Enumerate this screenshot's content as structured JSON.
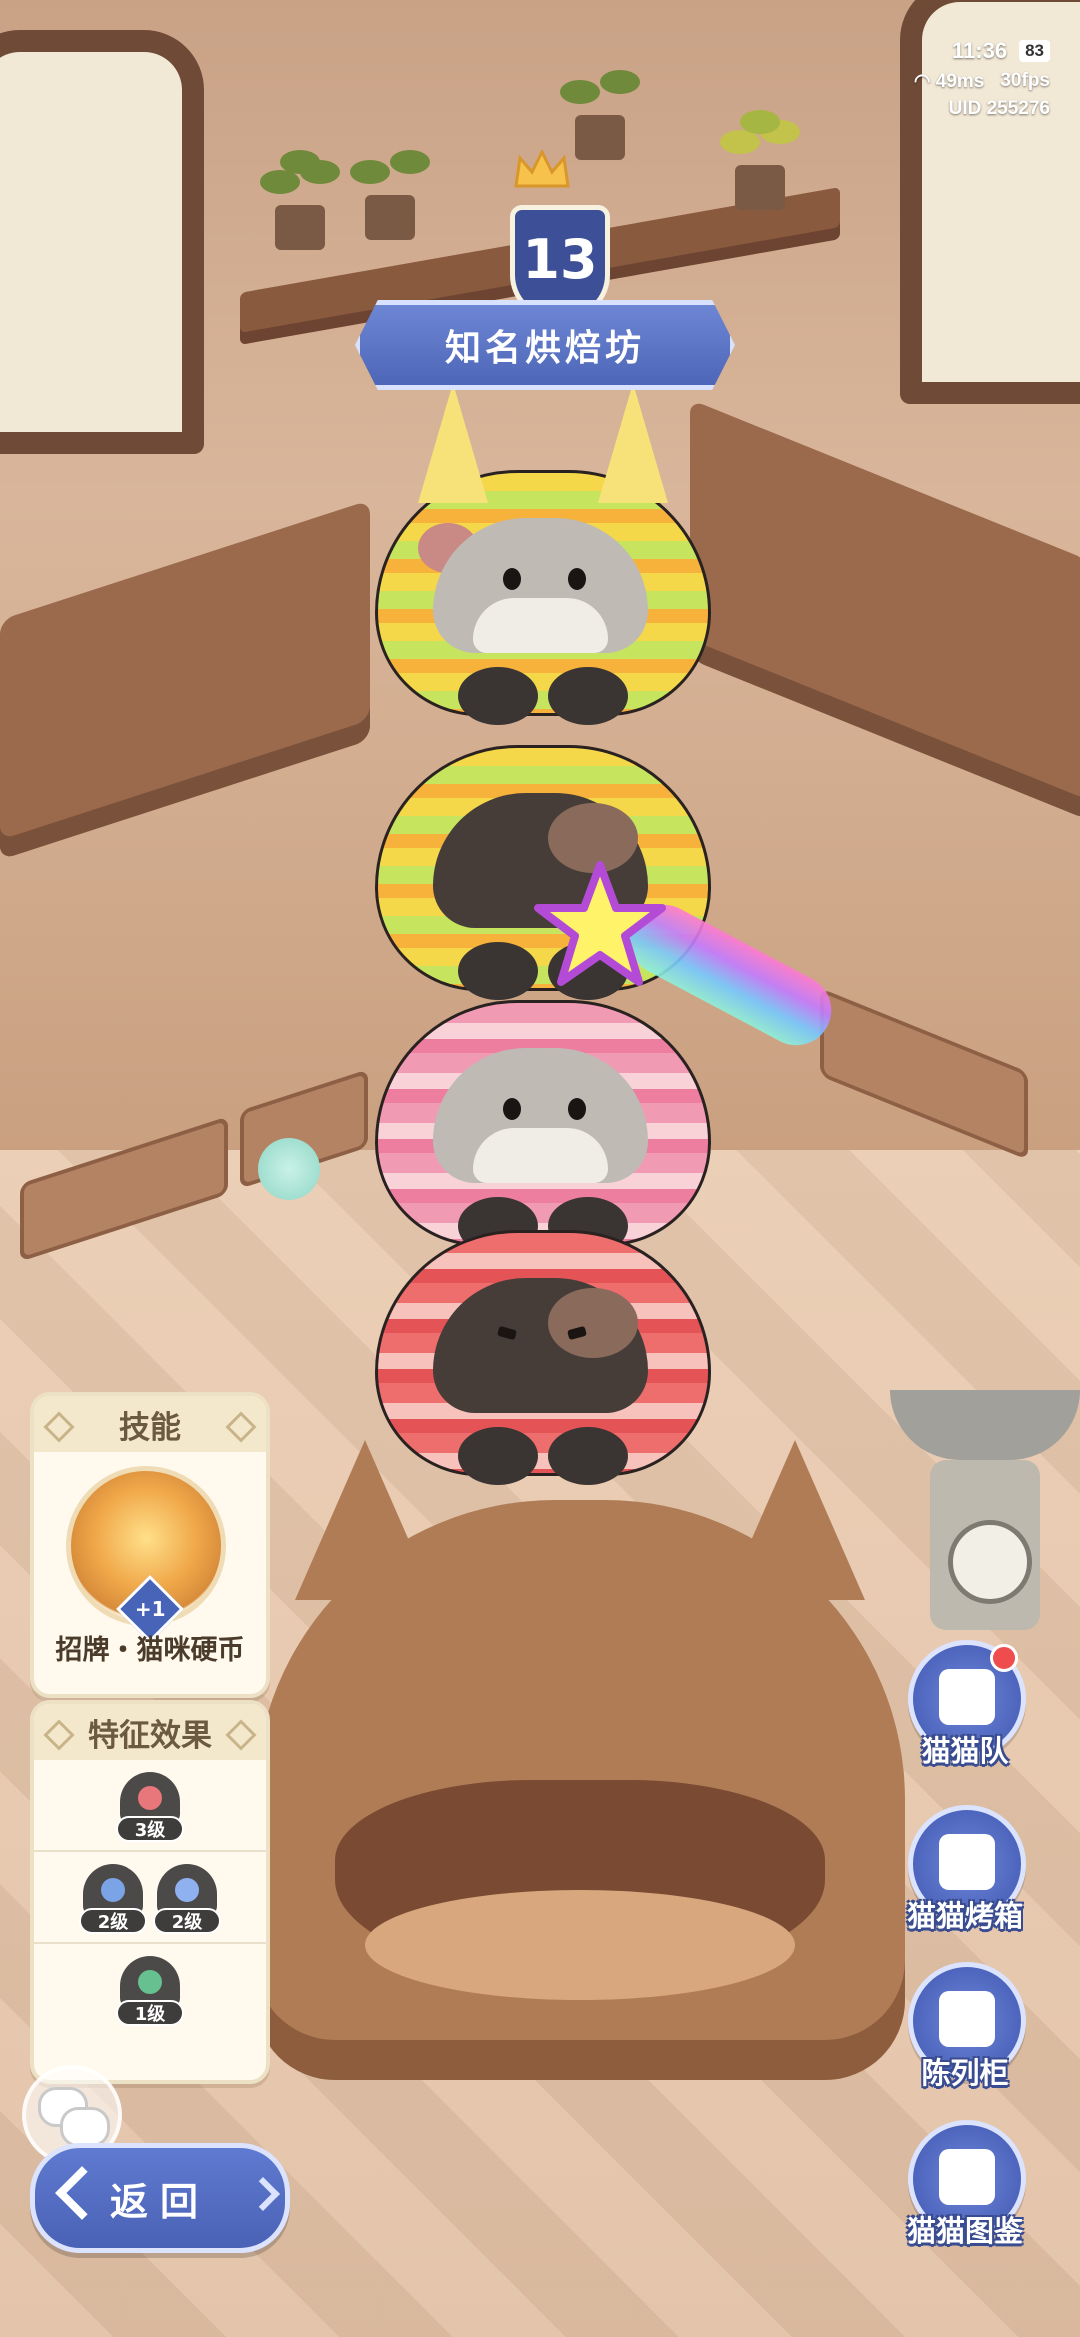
{
  "status": {
    "time": "11:36",
    "battery": "83",
    "ping": "49ms",
    "fps": "30fps",
    "uid": "UID  255276"
  },
  "shop": {
    "level": "13",
    "name": "知名烘焙坊"
  },
  "skill_panel": {
    "title": "技能",
    "badge": "+1",
    "skill_name": "招牌・猫咪硬币"
  },
  "traits_panel": {
    "title": "特征效果",
    "rows": [
      [
        {
          "level": "3级",
          "color": "#e7777a",
          "icon": "flower-icon"
        }
      ],
      [
        {
          "level": "2级",
          "color": "#7aa4e6",
          "icon": "wave-icon"
        },
        {
          "level": "2级",
          "color": "#8fb1ef",
          "icon": "triangle-icon"
        }
      ],
      [
        {
          "level": "1级",
          "color": "#67c08f",
          "icon": "snowflake-icon"
        }
      ]
    ]
  },
  "side_menu": [
    {
      "label": "猫猫队",
      "icon": "cat-team-icon",
      "notify": true
    },
    {
      "label": "猫猫烤箱",
      "icon": "oven-icon",
      "notify": false
    },
    {
      "label": "陈列柜",
      "icon": "cabinet-icon",
      "notify": false
    },
    {
      "label": "猫猫图鉴",
      "icon": "catalog-icon",
      "notify": false
    }
  ],
  "back_button": {
    "label": "返回"
  },
  "colors": {
    "accent": "#4a62b5",
    "panel": "#fff9ee",
    "notify": "#ef4d4d"
  }
}
